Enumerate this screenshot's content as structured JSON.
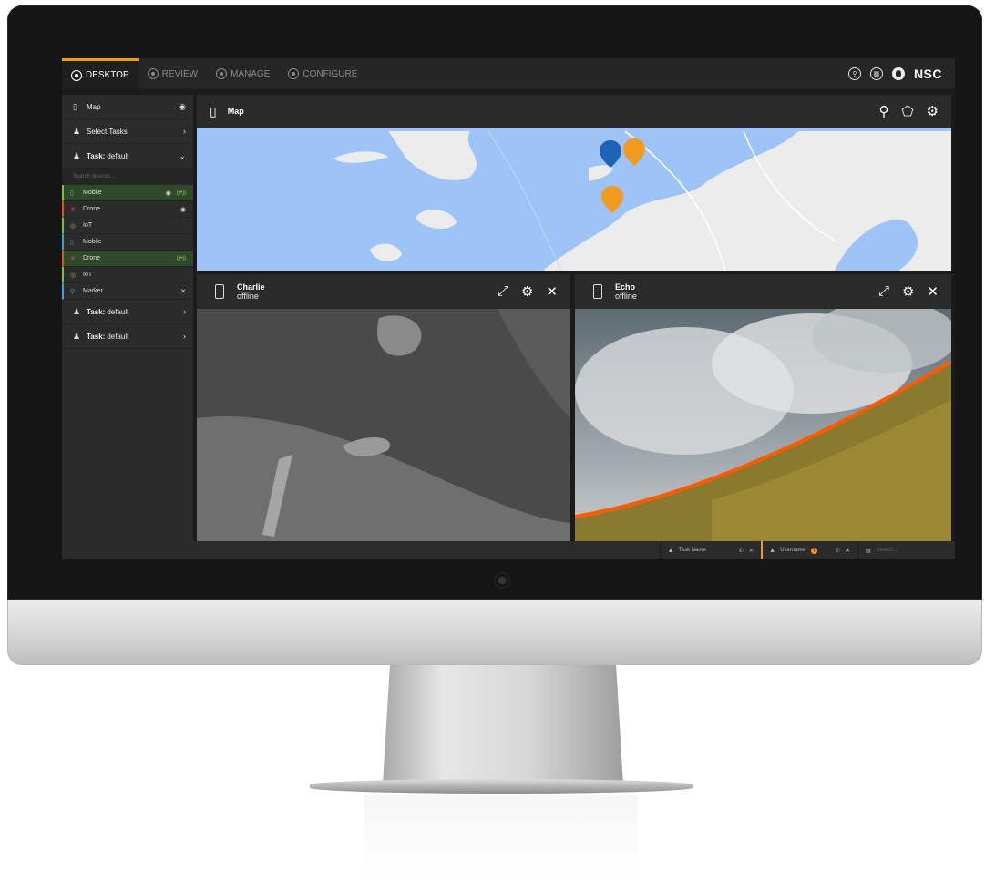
{
  "nav": {
    "tabs": [
      {
        "label": "DESKTOP",
        "active": true
      },
      {
        "label": "REVIEW"
      },
      {
        "label": "MANAGE"
      },
      {
        "label": "CONFIGURE"
      }
    ],
    "brand": "NSC",
    "accent": "#f29a1f"
  },
  "sidebar": {
    "map_label": "Map",
    "select_tasks": "Select Tasks",
    "task_prefix": "Task:",
    "task_value": "default",
    "search_placeholder": "Search devices ...",
    "devices": [
      {
        "label": "Mobile",
        "color": "#7bc043",
        "highlight": true
      },
      {
        "label": "Drone",
        "color": "#e0502a"
      },
      {
        "label": "IoT",
        "color": "#7bc043"
      },
      {
        "label": "Mobile",
        "color": "#3fa0d8"
      },
      {
        "label": "Drone",
        "color": "#e0502a",
        "highlight": true
      },
      {
        "label": "IoT",
        "color": "#7bc043"
      },
      {
        "label": "Marker",
        "color": "#3fa0d8"
      }
    ],
    "extra_tasks": [
      {
        "prefix": "Task:",
        "value": "default"
      },
      {
        "prefix": "Task:",
        "value": "default"
      }
    ]
  },
  "map_panel": {
    "title": "Map"
  },
  "cameras": [
    {
      "name": "Charlie",
      "status": "offline",
      "stripe": "#e0502a"
    },
    {
      "name": "Echo",
      "status": "offline",
      "stripe": "#2fb8a8"
    }
  ],
  "bottombar": {
    "task_name": "Task Name",
    "username": "Username",
    "badge": "1",
    "search_placeholder": "Search..."
  }
}
